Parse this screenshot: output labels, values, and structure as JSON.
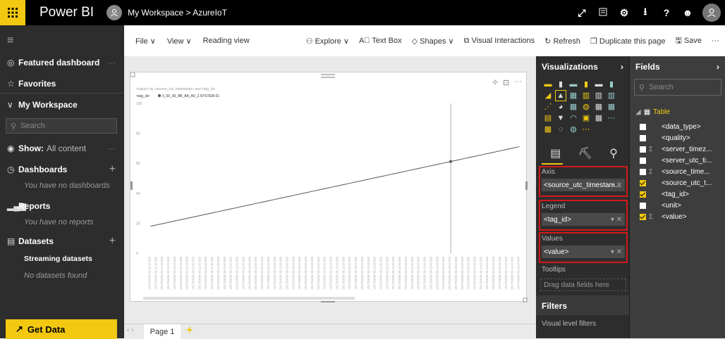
{
  "topbar": {
    "brand": "Power BI",
    "breadcrumb": "My Workspace  >  AzureIoT"
  },
  "leftnav": {
    "featured": "Featured dashboard",
    "favorites": "Favorites",
    "my_workspace": "My Workspace",
    "search_placeholder": "Search",
    "show_label": "Show:",
    "show_value": "All content",
    "dashboards": "Dashboards",
    "dashboards_empty": "You have no dashboards",
    "reports": "Reports",
    "reports_empty": "You have no reports",
    "datasets": "Datasets",
    "streaming": "Streaming datasets",
    "datasets_empty": "No datasets found",
    "get_data": "Get Data"
  },
  "toolbar": {
    "file": "File",
    "view": "View",
    "reading_view": "Reading view",
    "explore": "Explore",
    "text_box": "Text Box",
    "shapes": "Shapes",
    "visual_interactions": "Visual Interactions",
    "refresh": "Refresh",
    "duplicate": "Duplicate this page",
    "save": "Save"
  },
  "chart": {
    "subtitle": "<value> by <source_utc_timestamp> and <tag_id>",
    "legend_label": "<tag_id>",
    "legend_series": "0_00_90_8B_AA_A0_2.SYSTEM.01"
  },
  "chart_data": {
    "type": "line",
    "title": "<value> by <source_utc_timestamp> and <tag_id>",
    "xlabel": "",
    "ylabel": "",
    "ylim": [
      0,
      100
    ],
    "yticks": [
      "0",
      "20",
      "40",
      "60",
      "80",
      "100"
    ],
    "x": [
      "2017/04/06 06:12:16.000",
      "2017/04/06 06:12:18.000",
      "2017/04/06 06:12:20.000",
      "2017/04/06 06:12:22.000",
      "2017/04/06 06:12:24.000",
      "2017/04/06 06:12:26.000",
      "2017/04/06 06:12:28.000",
      "2017/04/06 06:12:30.000",
      "2017/04/06 06:12:32.000",
      "2017/04/06 06:12:34.000",
      "2017/04/06 06:12:36.000",
      "2017/04/06 06:12:38.000",
      "2017/04/06 06:12:40.000",
      "2017/04/06 06:12:42.000",
      "2017/04/06 06:12:44.000",
      "2017/04/06 06:12:46.000",
      "2017/04/06 06:12:48.000",
      "2017/04/06 06:12:50.000",
      "2017/04/06 06:12:52.000",
      "2017/04/06 06:12:54.000",
      "2017/04/06 06:12:56.000",
      "2017/04/06 06:12:58.000",
      "2017/04/06 06:13:00.000",
      "2017/04/06 06:13:02.000",
      "2017/04/06 06:13:04.000",
      "2017/04/06 06:13:06.000",
      "2017/04/06 06:13:08.000",
      "2017/04/06 06:13:10.000",
      "2017/04/06 06:13:12.000",
      "2017/04/06 06:13:14.000",
      "2017/04/06 06:13:16.000",
      "2017/04/06 06:13:18.000",
      "2017/04/06 06:13:20.000",
      "2017/04/06 06:13:22.000",
      "2017/04/06 06:13:24.000",
      "2017/04/06 06:13:26.000",
      "2017/04/06 06:13:28.000",
      "2017/04/06 06:13:30.000",
      "2017/04/06 06:13:32.000",
      "2017/04/06 06:13:34.000",
      "2017/04/06 06:13:36.000",
      "2017/04/06 06:13:38.000",
      "2017/04/06 06:13:40.000",
      "2017/04/06 06:13:42.000",
      "2017/04/06 06:13:44.000",
      "2017/04/06 06:13:46.000",
      "2017/04/06 06:13:48.000",
      "2017/04/06 06:13:50.000",
      "2017/04/06 06:13:52.000",
      "2017/04/06 06:13:54.000",
      "2017/04/06 06:13:56.000",
      "2017/04/06 06:13:58.000",
      "2017/04/06 06:14:00.000",
      "2017/04/06 06:14:02.000",
      "2017/04/06 06:14:04.000",
      "2017/04/06 06:14:06.000",
      "2017/04/06 06:14:08.000",
      "2017/04/06 06:14:10.000",
      "2017/04/06 06:14:12.000",
      "2017/04/06 06:14:14.000"
    ],
    "series": [
      {
        "name": "0_00_90_8B_AA_A0_2.SYSTEM.01",
        "values": [
          18,
          18.9,
          19.8,
          20.7,
          21.6,
          22.5,
          23.4,
          24.3,
          25.2,
          26.1,
          27.0,
          27.9,
          28.8,
          29.7,
          30.6,
          31.5,
          32.4,
          33.3,
          34.2,
          35.1,
          36.0,
          36.9,
          37.8,
          38.7,
          39.6,
          40.5,
          41.4,
          42.3,
          43.2,
          44.1,
          45.0,
          45.9,
          46.8,
          47.7,
          48.6,
          49.5,
          50.4,
          51.3,
          52.2,
          53.1,
          54.0,
          54.9,
          55.8,
          56.7,
          57.6,
          58.5,
          59.4,
          60.3,
          61.2,
          62.1,
          63.0,
          63.9,
          64.8,
          65.7,
          66.6,
          67.5,
          68.4,
          69.3,
          70.2,
          71.1
        ]
      }
    ],
    "grid": false,
    "legend_position": "top-left",
    "line_color": "#555555"
  },
  "visualizations": {
    "title": "Visualizations",
    "axis_label": "Axis",
    "axis_value": "<source_utc_timestam...",
    "legend_label": "Legend",
    "legend_value": "<tag_id>",
    "values_label": "Values",
    "values_value": "<value>",
    "tooltips_label": "Tooltips",
    "drag_hint": "Drag data fields here",
    "filters_title": "Filters",
    "visual_level_filters": "Visual level filters"
  },
  "fields": {
    "title": "Fields",
    "search_placeholder": "Search",
    "table_name": "Table",
    "items": [
      {
        "name": "<data_type>",
        "checked": false,
        "sigma": false
      },
      {
        "name": "<quality>",
        "checked": false,
        "sigma": false
      },
      {
        "name": "<server_timez...",
        "checked": false,
        "sigma": true
      },
      {
        "name": "<server_utc_ti...",
        "checked": false,
        "sigma": false
      },
      {
        "name": "<source_time...",
        "checked": false,
        "sigma": true
      },
      {
        "name": "<source_utc_t...",
        "checked": true,
        "sigma": false
      },
      {
        "name": "<tag_id>",
        "checked": true,
        "sigma": false
      },
      {
        "name": "<unit>",
        "checked": false,
        "sigma": false
      },
      {
        "name": "<value>",
        "checked": true,
        "sigma": true
      }
    ]
  },
  "pages": {
    "page1": "Page 1"
  },
  "colors": {
    "accent": "#f2c811",
    "highlight": "#d21919",
    "nav_bg": "#2d2d2d"
  }
}
